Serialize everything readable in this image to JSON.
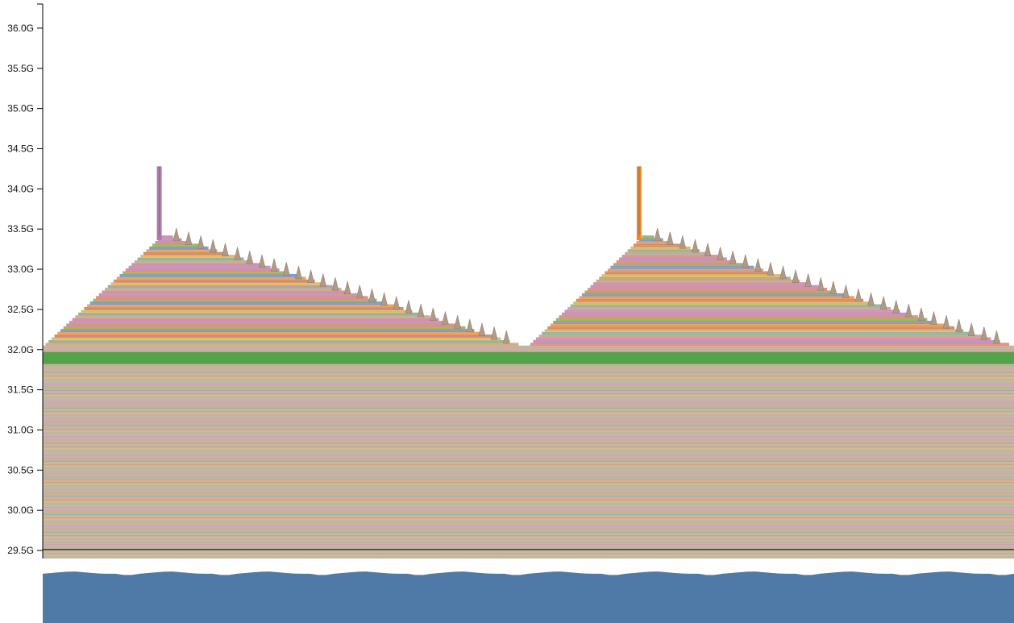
{
  "chart_data": {
    "type": "area",
    "title": "",
    "xlabel": "",
    "ylabel": "",
    "yticks": [
      {
        "label": "29.5G",
        "value": 29.5
      },
      {
        "label": "30.0G",
        "value": 30.0
      },
      {
        "label": "30.5G",
        "value": 30.5
      },
      {
        "label": "31.0G",
        "value": 31.0
      },
      {
        "label": "31.5G",
        "value": 31.5
      },
      {
        "label": "32.0G",
        "value": 32.0
      },
      {
        "label": "32.5G",
        "value": 32.5
      },
      {
        "label": "33.0G",
        "value": 33.0
      },
      {
        "label": "33.5G",
        "value": 33.5
      },
      {
        "label": "34.0G",
        "value": 34.0
      },
      {
        "label": "34.5G",
        "value": 34.5
      },
      {
        "label": "35.0G",
        "value": 35.0
      },
      {
        "label": "35.5G",
        "value": 35.5
      },
      {
        "label": "36.0G",
        "value": 36.0
      }
    ],
    "ylim": [
      29.4,
      36.3
    ],
    "xlim": [
      0,
      1
    ],
    "grid": false,
    "legend": "none",
    "stack_base_value": 29.4,
    "stable_top_value": 32.05,
    "baseline_band": {
      "bottom_value": 31.82,
      "top_value": 31.97,
      "color": "#55a349"
    },
    "cycles": [
      {
        "start": 0.003,
        "peak": 0.125,
        "end": 0.49,
        "peak_value": 33.42,
        "spike_x": 0.12,
        "spike_value": 34.28,
        "spike_color": "#b07aa8"
      },
      {
        "start": 0.502,
        "peak": 0.62,
        "end": 0.995,
        "peak_value": 33.42,
        "spike_x": 0.614,
        "spike_value": 34.28,
        "spike_color": "#f08a22"
      }
    ],
    "palette": [
      "#c7b299",
      "#e08e8e",
      "#f4a259",
      "#8fb8a0",
      "#b89ac6",
      "#6f9fd0",
      "#e6c36a",
      "#d58fb2",
      "#9cb85c",
      "#c98e6a"
    ],
    "overview": {
      "type": "area",
      "color": "#4f79a7",
      "level": 0.92
    }
  }
}
